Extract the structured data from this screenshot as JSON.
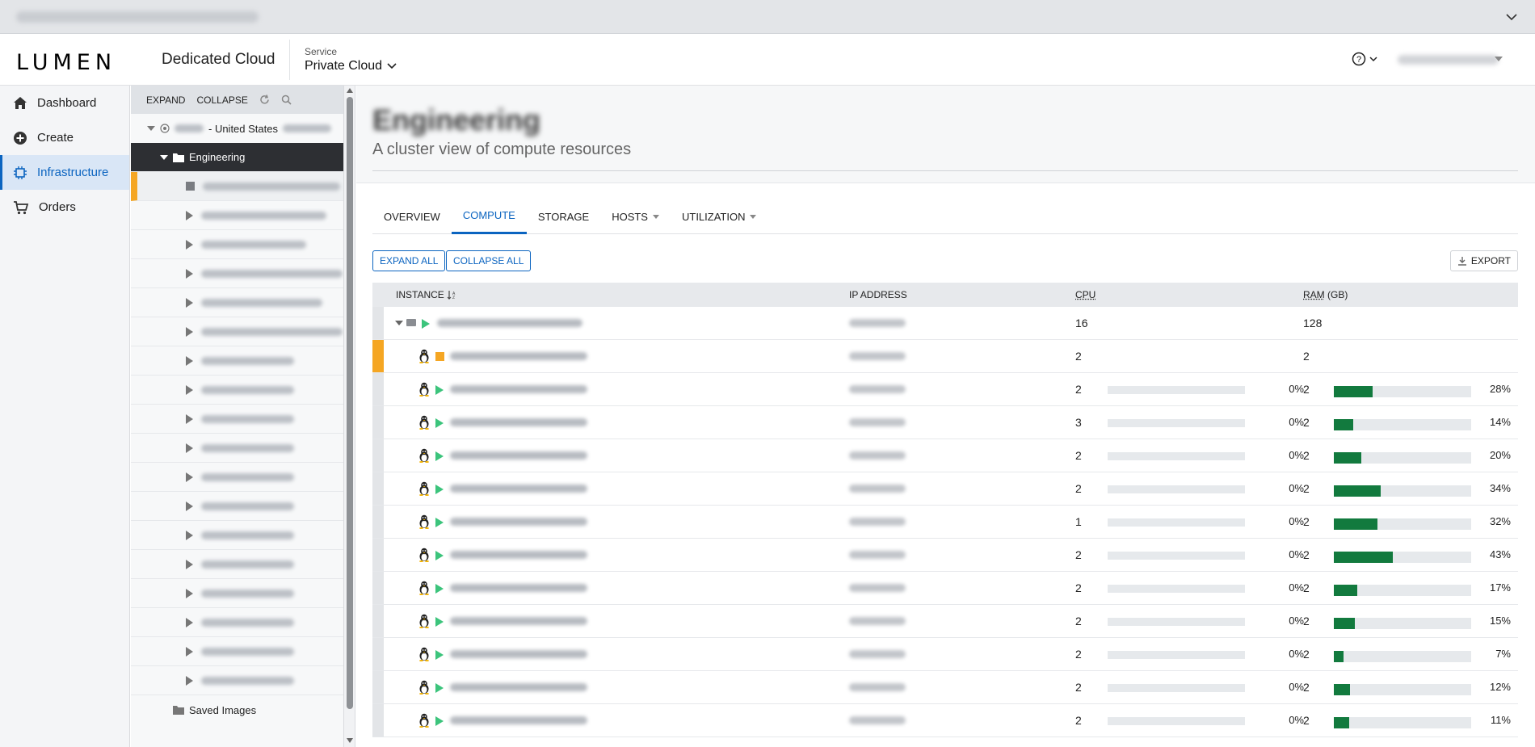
{
  "header": {
    "logo": "LUMEN",
    "product": "Dedicated Cloud",
    "service_label": "Service",
    "service_value": "Private Cloud"
  },
  "nav": [
    {
      "label": "Dashboard",
      "icon": "home-icon"
    },
    {
      "label": "Create",
      "icon": "plus-circle-icon"
    },
    {
      "label": "Infrastructure",
      "icon": "chip-icon",
      "active": true
    },
    {
      "label": "Orders",
      "icon": "cart-icon"
    }
  ],
  "tree": {
    "expand": "EXPAND",
    "collapse": "COLLAPSE",
    "root_label": "- United States",
    "selected_folder": "Engineering",
    "saved_images": "Saved Images"
  },
  "page": {
    "title": "Engineering",
    "subtitle": "A cluster view of compute resources"
  },
  "tabs": [
    "OVERVIEW",
    "COMPUTE",
    "STORAGE",
    "HOSTS",
    "UTILIZATION"
  ],
  "active_tab": "COMPUTE",
  "buttons": {
    "expand_all": "EXPAND ALL",
    "collapse_all": "COLLAPSE ALL",
    "export": "EXPORT"
  },
  "grid": {
    "headers": {
      "instance": "INSTANCE",
      "ip": "IP ADDRESS",
      "cpu": "CPU",
      "ram": "RAM",
      "ram_unit": "(GB)"
    },
    "parent": {
      "cpu": "16",
      "ram": "128"
    },
    "rows": [
      {
        "cpu": "2",
        "ram": "2",
        "cpu_pct": null,
        "ram_pct": null,
        "state": "stopped",
        "selected": true
      },
      {
        "cpu": "2",
        "ram": "2",
        "cpu_pct": "0%",
        "ram_pct": "28%",
        "ram_fill": 0.28
      },
      {
        "cpu": "3",
        "ram": "2",
        "cpu_pct": "0%",
        "ram_pct": "14%",
        "ram_fill": 0.14
      },
      {
        "cpu": "2",
        "ram": "2",
        "cpu_pct": "0%",
        "ram_pct": "20%",
        "ram_fill": 0.2
      },
      {
        "cpu": "2",
        "ram": "2",
        "cpu_pct": "0%",
        "ram_pct": "34%",
        "ram_fill": 0.34
      },
      {
        "cpu": "1",
        "ram": "2",
        "cpu_pct": "0%",
        "ram_pct": "32%",
        "ram_fill": 0.32
      },
      {
        "cpu": "2",
        "ram": "2",
        "cpu_pct": "0%",
        "ram_pct": "43%",
        "ram_fill": 0.43
      },
      {
        "cpu": "2",
        "ram": "2",
        "cpu_pct": "0%",
        "ram_pct": "17%",
        "ram_fill": 0.17
      },
      {
        "cpu": "2",
        "ram": "2",
        "cpu_pct": "0%",
        "ram_pct": "15%",
        "ram_fill": 0.15
      },
      {
        "cpu": "2",
        "ram": "2",
        "cpu_pct": "0%",
        "ram_pct": "7%",
        "ram_fill": 0.07
      },
      {
        "cpu": "2",
        "ram": "2",
        "cpu_pct": "0%",
        "ram_pct": "12%",
        "ram_fill": 0.12
      },
      {
        "cpu": "2",
        "ram": "2",
        "cpu_pct": "0%",
        "ram_pct": "11%",
        "ram_fill": 0.11
      }
    ]
  },
  "colors": {
    "accent": "#0b64c0",
    "bar": "#127a3e",
    "selected": "#f5a623",
    "running": "#3cc47c"
  }
}
